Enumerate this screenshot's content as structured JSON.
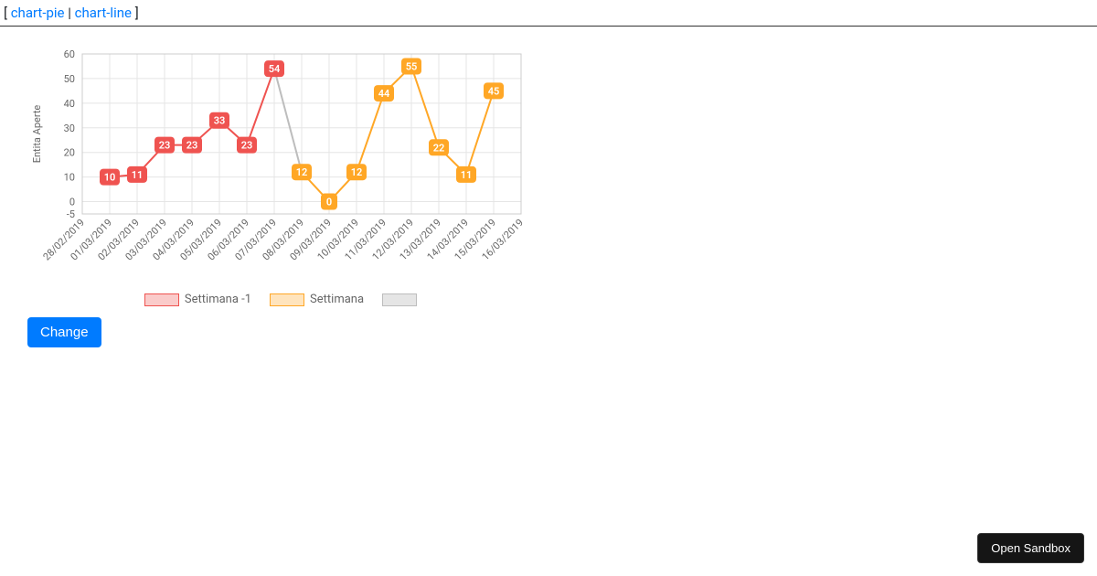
{
  "nav": {
    "bracket_open": "[ ",
    "pie": "chart-pie",
    "sep": " | ",
    "line": "chart-line",
    "bracket_close": " ]"
  },
  "chart_data": {
    "type": "line",
    "ylabel": "Entita Aperte",
    "ylim": [
      -5,
      60
    ],
    "yticks": [
      -5,
      0,
      10,
      20,
      30,
      40,
      50,
      60
    ],
    "categories": [
      "28/02/2019",
      "01/03/2019",
      "02/03/2019",
      "03/03/2019",
      "04/03/2019",
      "05/03/2019",
      "06/03/2019",
      "07/03/2019",
      "08/03/2019",
      "09/03/2019",
      "10/03/2019",
      "11/03/2019",
      "12/03/2019",
      "13/03/2019",
      "14/03/2019",
      "15/03/2019",
      "16/03/2019"
    ],
    "series": [
      {
        "name": "Settimana -1",
        "color": "#ef5350",
        "x": [
          "01/03/2019",
          "02/03/2019",
          "03/03/2019",
          "04/03/2019",
          "05/03/2019",
          "06/03/2019",
          "07/03/2019"
        ],
        "values": [
          10,
          11,
          23,
          23,
          33,
          23,
          54
        ]
      },
      {
        "name": "Settimana",
        "color": "#ffa726",
        "x": [
          "08/03/2019",
          "09/03/2019",
          "10/03/2019",
          "11/03/2019",
          "12/03/2019",
          "13/03/2019",
          "14/03/2019",
          "15/03/2019"
        ],
        "values": [
          12,
          0,
          12,
          44,
          55,
          22,
          11,
          45
        ]
      },
      {
        "name": "",
        "color": "#bdbdbd",
        "x": [
          "07/03/2019",
          "08/03/2019"
        ],
        "values": [
          54,
          12
        ]
      }
    ],
    "legend_labels": [
      "Settimana -1",
      "Settimana",
      ""
    ]
  },
  "buttons": {
    "change": "Change",
    "open_sandbox": "Open Sandbox"
  }
}
